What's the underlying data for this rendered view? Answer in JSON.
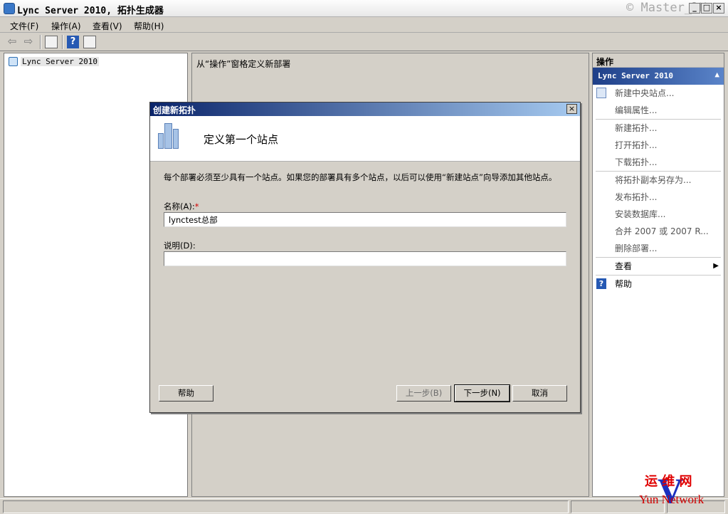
{
  "window": {
    "title": "Lync Server 2010, 拓扑生成器",
    "watermark": "© Master_lK",
    "min_label": "_",
    "max_label": "□",
    "close_label": "×"
  },
  "menu": {
    "file": "文件(F)",
    "action": "操作(A)",
    "view": "查看(V)",
    "help": "帮助(H)"
  },
  "toolbar": {
    "back_icon": "back-arrow-icon",
    "forward_icon": "forward-arrow-icon",
    "help_glyph": "?"
  },
  "tree": {
    "root_label": "Lync Server 2010"
  },
  "center": {
    "hint": "从“操作”窗格定义新部署"
  },
  "actions": {
    "header": "操作",
    "section_title": "Lync Server 2010",
    "items": [
      "新建中央站点...",
      "编辑属性...",
      "新建拓扑...",
      "打开拓扑...",
      "下载拓扑...",
      "将拓扑副本另存为...",
      "发布拓扑...",
      "安装数据库...",
      "合并 2007 或 2007 R...",
      "删除部署..."
    ],
    "view_label": "查看",
    "help_label": "帮助",
    "help_glyph": "?"
  },
  "dialog": {
    "title": "创建新拓扑",
    "close_label": "×",
    "heading": "定义第一个站点",
    "description": "每个部署必须至少具有一个站点。如果您的部署具有多个站点，以后可以使用“新建站点”向导添加其他站点。",
    "name_label": "名称(A):",
    "required_mark": "*",
    "name_value": "lynctest总部",
    "desc_label": "说明(D):",
    "desc_value": "",
    "buttons": {
      "help": "帮助",
      "back": "上一步(B)",
      "next": "下一步(N)",
      "cancel": "取消"
    }
  },
  "logo": {
    "line1": "运 维 网",
    "line2": "Yun   Network",
    "mark": "V"
  }
}
